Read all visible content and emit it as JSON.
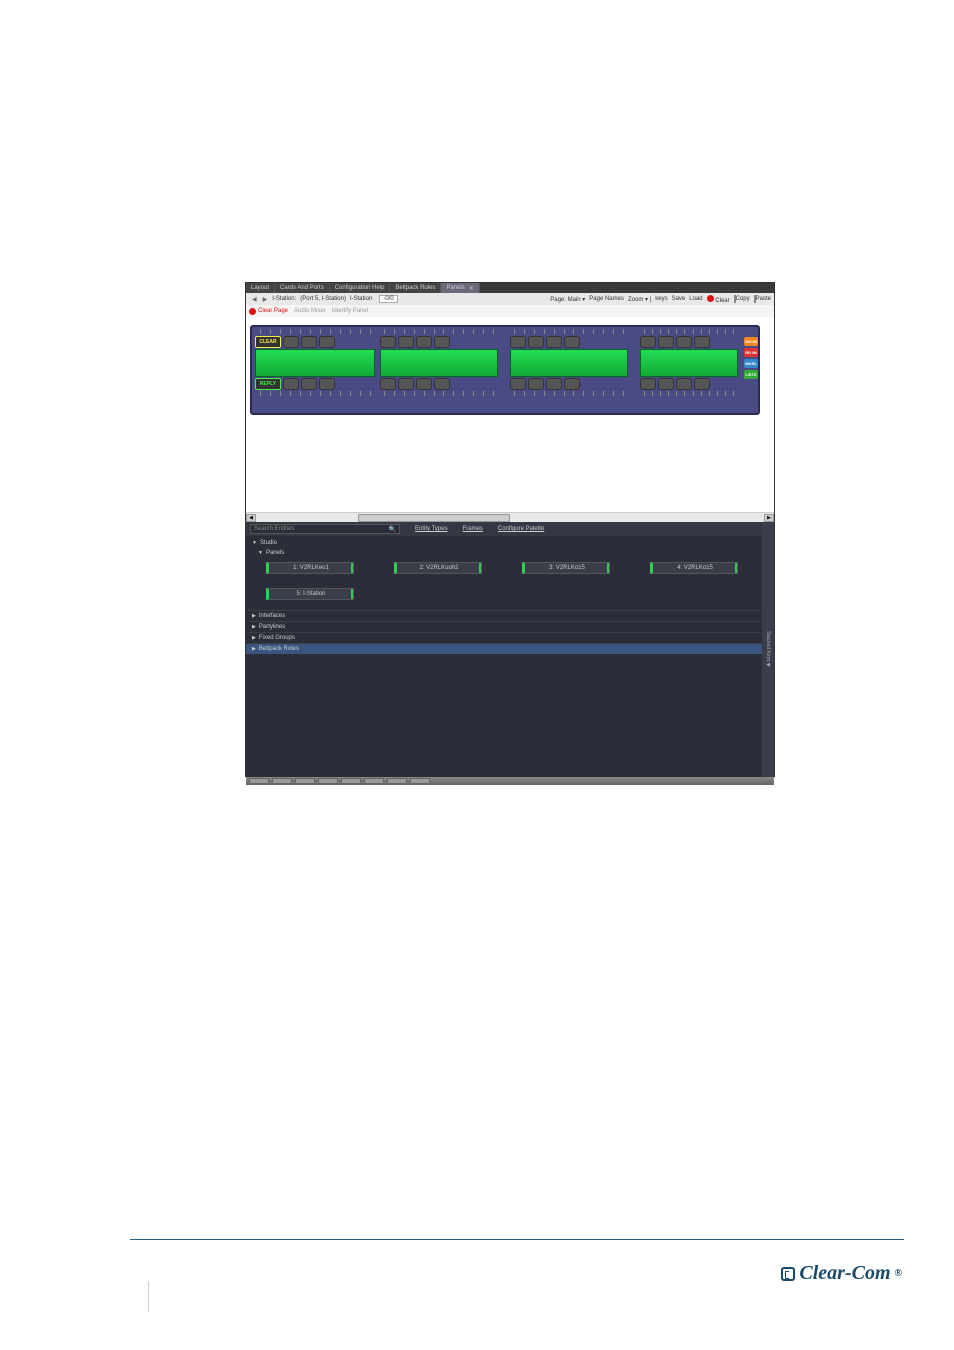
{
  "tabs": [
    "Layout",
    "Cards And Ports",
    "Configuration Help",
    "Beltpack Roles",
    "Panels"
  ],
  "active_tab": "Panels",
  "breadcrumb": {
    "back": "◀",
    "fwd": "▶",
    "items": [
      "I-Station:",
      "(Port 5, I-Station)",
      "I-Station"
    ],
    "dropdown": "0/0"
  },
  "right_menu": {
    "page_main": "Page: Main",
    "page_names": "Page Names",
    "zoom": "Zoom",
    "keys": "keys",
    "save": "Save",
    "load": "Load",
    "clear": "Clear",
    "copy": "Copy",
    "paste": "Paste"
  },
  "toolbar": {
    "clear_page": "Clear Page",
    "audio_mixer": "Audio Mixer",
    "identify_panel": "Identify Panel"
  },
  "device": {
    "top_label": "CLEAR",
    "bottom_label": "REPLY",
    "side_labels": [
      "GM MI",
      "RD MI",
      "MKRL",
      "LISTE"
    ]
  },
  "search": {
    "placeholder": "Search Entities",
    "entity_types": "Entity Types",
    "frames": "Frames",
    "configure": "Configure Palette"
  },
  "tree": {
    "studio": "Studio",
    "panels": "Panels",
    "interfaces": "Interfaces",
    "partylines": "Partylines",
    "fixed_groups": "Fixed Groups",
    "beltpack_roles": "Beltpack Roles"
  },
  "palette": [
    "1: V2RLKeo1",
    "2: V2RLKuoh2",
    "3: V2RLKo15",
    "4: V2RLKo15",
    "5: I-Station"
  ],
  "side_tab": "Stacked Keys",
  "footer_brand": "Clear-Com"
}
